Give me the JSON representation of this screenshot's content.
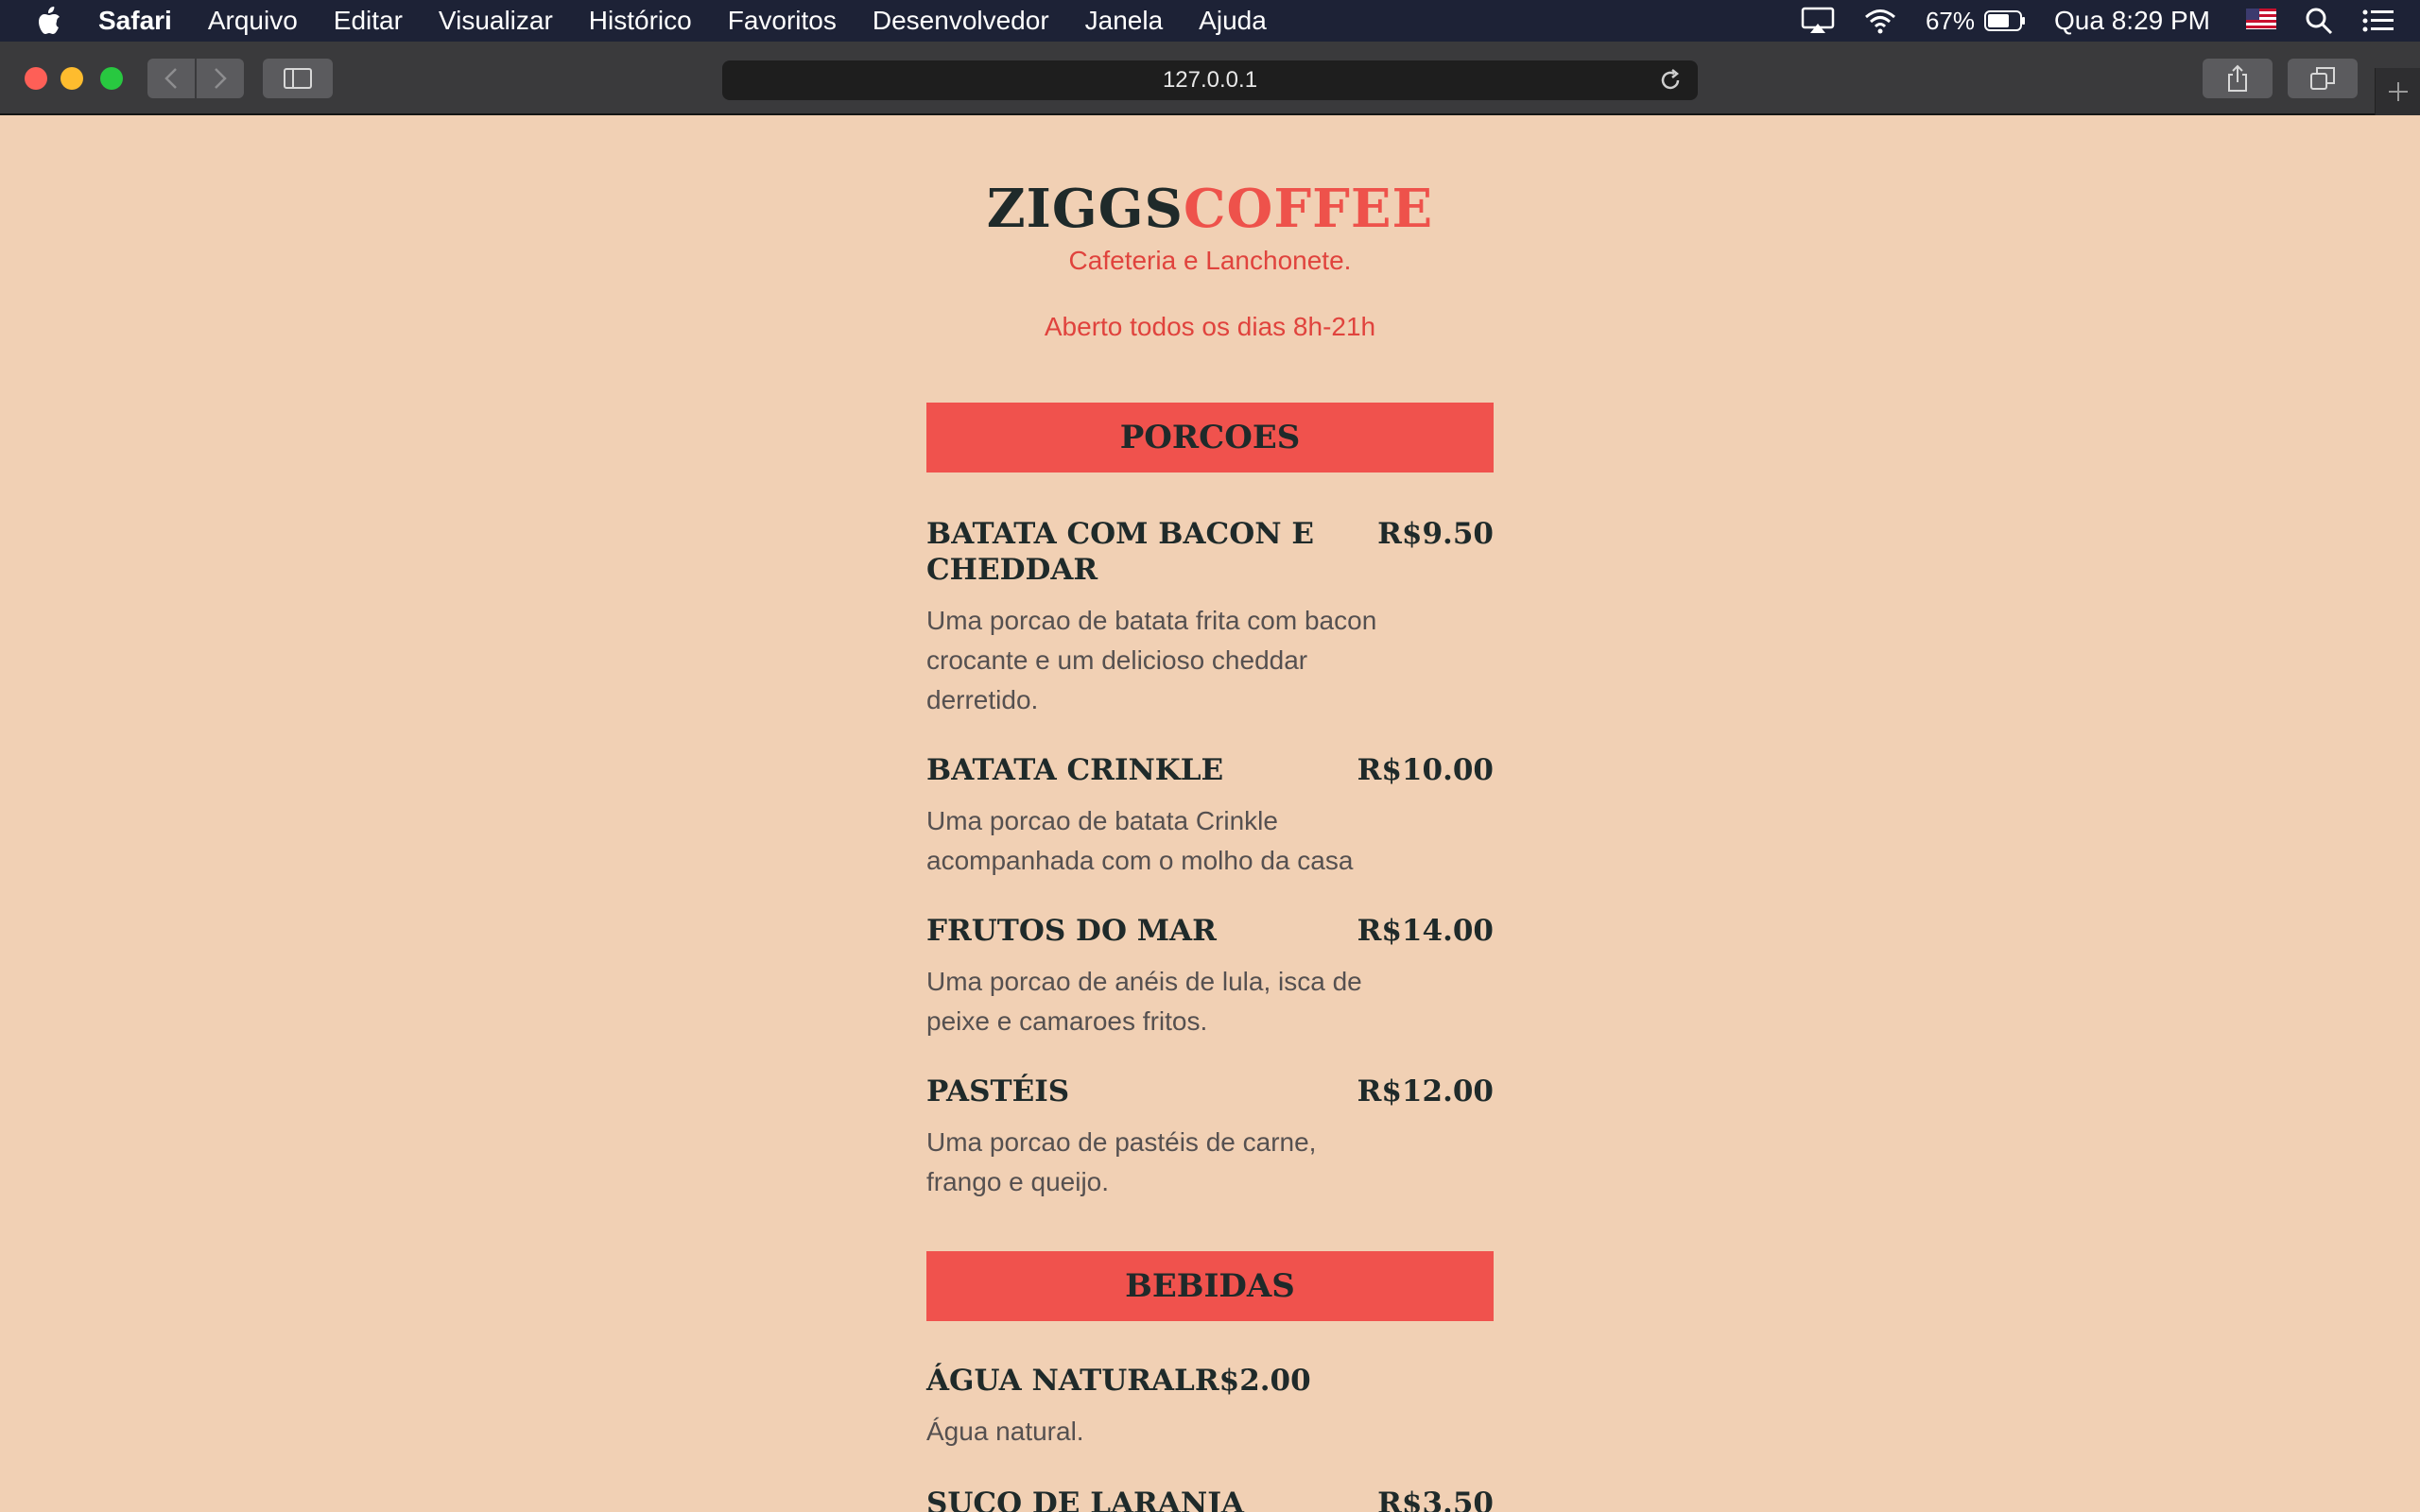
{
  "menubar": {
    "app_name": "Safari",
    "items": [
      "Arquivo",
      "Editar",
      "Visualizar",
      "Histórico",
      "Favoritos",
      "Desenvolvedor",
      "Janela",
      "Ajuda"
    ],
    "battery": "67%",
    "clock": "Qua 8:29 PM"
  },
  "browser": {
    "url": "127.0.0.1"
  },
  "site": {
    "logo_part1": "ZIGGS",
    "logo_part2": "COFFEE",
    "tagline": "Cafeteria e Lanchonete.",
    "hours": "Aberto todos os dias 8h-21h",
    "sections": [
      {
        "title": "PORCOES",
        "items": [
          {
            "name": "BATATA COM BACON E CHEDDAR",
            "price": "R$9.50",
            "desc": "Uma porcao de batata frita com bacon crocante e um delicioso cheddar derretido."
          },
          {
            "name": "BATATA CRINKLE",
            "price": "R$10.00",
            "desc": "Uma porcao de batata Crinkle acompanhada com o molho da casa"
          },
          {
            "name": "FRUTOS DO MAR",
            "price": "R$14.00",
            "desc": "Uma porcao de anéis de lula, isca de peixe e camaroes fritos."
          },
          {
            "name": "PASTÉIS",
            "price": "R$12.00",
            "desc": "Uma porcao de pastéis de carne, frango e queijo."
          }
        ]
      },
      {
        "title": "BEBIDAS",
        "items": [
          {
            "name": "ÁGUA NATURAL",
            "price": "R$2.00",
            "desc": "Água natural."
          },
          {
            "name": "SUCO DE LARANJA",
            "price": "R$3.50",
            "desc": ""
          }
        ]
      }
    ]
  }
}
